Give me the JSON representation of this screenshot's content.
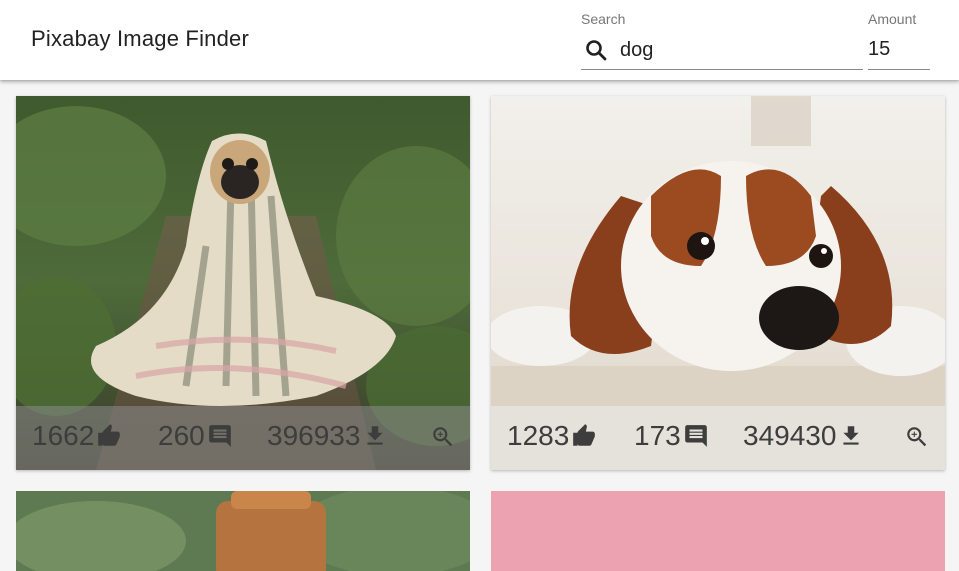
{
  "app": {
    "title": "Pixabay Image Finder"
  },
  "search": {
    "label": "Search",
    "value": "dog"
  },
  "amount": {
    "label": "Amount",
    "value": "15"
  },
  "images": [
    {
      "likes": "1662",
      "comments": "260",
      "downloads": "396933"
    },
    {
      "likes": "1283",
      "comments": "173",
      "downloads": "349430"
    }
  ],
  "icons": {
    "search": "search-icon",
    "like": "thumb-up-icon",
    "comment": "comment-icon",
    "download": "download-icon",
    "zoom": "zoom-in-icon"
  }
}
